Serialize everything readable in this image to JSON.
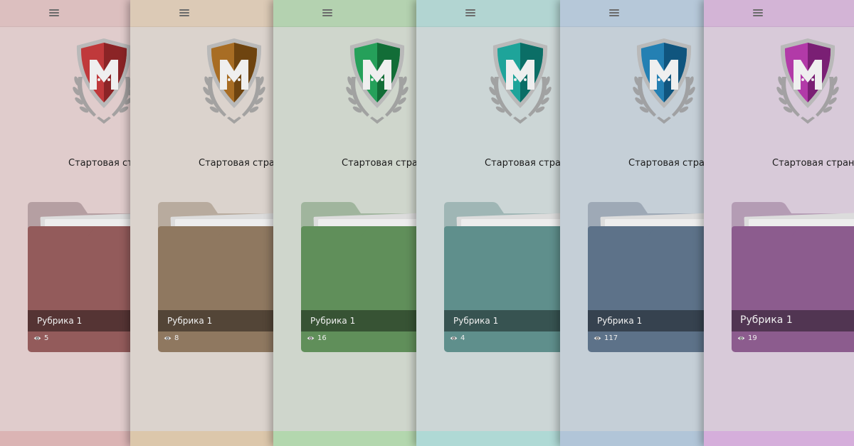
{
  "page": {
    "title": "Стартовая страница",
    "category_label": "Рубрика 1"
  },
  "themes": [
    {
      "name": "red",
      "bg": "#e0cccc",
      "topbar": "#dcbfbf",
      "bottom": "#dbb4b4",
      "shield": "#c0393b",
      "shield_dark": "#8b2426",
      "folder_back": "#b59fa2",
      "folder": "#935b5b",
      "views": "5"
    },
    {
      "name": "brown",
      "bg": "#dbd3cd",
      "topbar": "#dccab6",
      "bottom": "#dcc7ab",
      "shield": "#a86d24",
      "shield_dark": "#6e4410",
      "folder_back": "#b8ab9e",
      "folder": "#8f7860",
      "views": "8"
    },
    {
      "name": "green",
      "bg": "#cfd6cc",
      "topbar": "#b4d2b0",
      "bottom": "#b3d7ae",
      "shield": "#25a05a",
      "shield_dark": "#126d37",
      "folder_back": "#a0b59d",
      "folder": "#608f5a",
      "views": "16"
    },
    {
      "name": "teal",
      "bg": "#ccd6d6",
      "topbar": "#b2d5d2",
      "bottom": "#afd9d5",
      "shield": "#1ea49a",
      "shield_dark": "#0b6e66",
      "folder_back": "#9fb6b5",
      "folder": "#5f8f8c",
      "views": "4"
    },
    {
      "name": "blue",
      "bg": "#c5cfd7",
      "topbar": "#b6c8d9",
      "bottom": "#b1c5d8",
      "shield": "#2480b3",
      "shield_dark": "#10557e",
      "folder_back": "#9ea9b6",
      "folder": "#5d7289",
      "views": "117"
    },
    {
      "name": "purple",
      "bg": "#d8cad9",
      "topbar": "#d3b4d6",
      "bottom": "#d5aedb",
      "shield": "#b23aa8",
      "shield_dark": "#7a1f74",
      "folder_back": "#b49cb4",
      "folder": "#8c5c8e",
      "views": "19"
    }
  ],
  "icons": {
    "menu": "hamburger-menu-icon",
    "views": "eye-icon",
    "logo": "shield-crown-logo"
  }
}
